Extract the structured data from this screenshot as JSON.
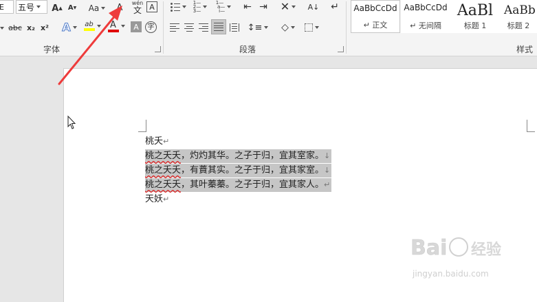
{
  "ribbon": {
    "font": {
      "font_size_value": "五号",
      "case_button": "Aa",
      "clear_format_char": "A",
      "phonetic_top": "wén",
      "phonetic_char": "文",
      "border_char": "A",
      "strike": "abc",
      "subscript": "x₂",
      "superscript": "x²",
      "effects_char": "A",
      "highlight_char": "ab",
      "font_color_char": "A",
      "shade_char": "A",
      "enclose_char": "字",
      "group_label": "字体"
    },
    "paragraph": {
      "group_label": "段落"
    },
    "styles": {
      "group_label": "样式",
      "items": [
        {
          "sample": "AaBbCcDd",
          "name": "↵ 正文"
        },
        {
          "sample": "AaBbCcDd",
          "name": "↵ 无间隔"
        },
        {
          "sample": "AaBl",
          "name": "标题 1"
        },
        {
          "sample": "AaBb",
          "name": "标题 2"
        }
      ]
    },
    "colors": {
      "highlight": "#ffff00",
      "font_color": "#e00000",
      "arrow": "#ee3b3b"
    }
  },
  "document": {
    "lines": [
      {
        "parts": [
          {
            "text": "桃夭",
            "squiggle": false
          }
        ],
        "mark": "↵",
        "highlighted": false
      },
      {
        "parts": [
          {
            "text": "桃之夭夭",
            "squiggle": true
          },
          {
            "text": "，灼灼其华。之子于归，宜其室家。",
            "squiggle": false
          }
        ],
        "mark": "↓",
        "highlighted": true
      },
      {
        "parts": [
          {
            "text": "桃之夭夭",
            "squiggle": true
          },
          {
            "text": "，有蕡其实。之子于归，宜其家室。",
            "squiggle": false
          }
        ],
        "mark": "↓",
        "highlighted": true
      },
      {
        "parts": [
          {
            "text": "桃之夭夭",
            "squiggle": true
          },
          {
            "text": "，其叶蓁蓁。之子于归，宜其家人。",
            "squiggle": false
          }
        ],
        "mark": "↵",
        "highlighted": true
      },
      {
        "parts": [
          {
            "text": "天妖",
            "squiggle": false
          }
        ],
        "mark": "↵",
        "highlighted": false
      }
    ]
  },
  "watermark": {
    "brand": "Bai",
    "brand_cn": "经验",
    "url": "jingyan.baidu.com"
  }
}
